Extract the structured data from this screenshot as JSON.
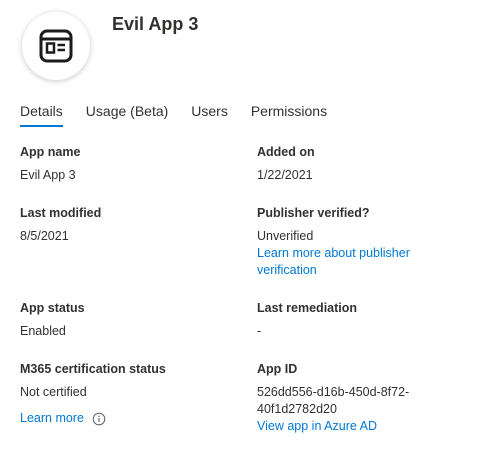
{
  "app": {
    "title": "Evil App 3",
    "icon": "app-window-icon"
  },
  "tabs": [
    {
      "label": "Details",
      "active": true
    },
    {
      "label": "Usage (Beta)",
      "active": false
    },
    {
      "label": "Users",
      "active": false
    },
    {
      "label": "Permissions",
      "active": false
    }
  ],
  "details": {
    "app_name": {
      "label": "App name",
      "value": "Evil App 3"
    },
    "added_on": {
      "label": "Added on",
      "value": "1/22/2021"
    },
    "last_modified": {
      "label": "Last modified",
      "value": "8/5/2021"
    },
    "publisher_verified": {
      "label": "Publisher verified?",
      "value": "Unverified",
      "link_line1": "Learn more about publisher",
      "link_line2": "verification"
    },
    "app_status": {
      "label": "App status",
      "value": "Enabled"
    },
    "last_remediation": {
      "label": "Last remediation",
      "value": "-"
    },
    "m365_cert": {
      "label": "M365 certification status",
      "value": "Not certified",
      "link": "Learn more",
      "info_icon": "info-icon"
    },
    "app_id": {
      "label": "App ID",
      "value_line1": "526dd556-d16b-450d-8f72-",
      "value_line2": "40f1d2782d20",
      "link": "View app in Azure AD"
    }
  },
  "colors": {
    "accent": "#0078d4",
    "text": "#323130"
  }
}
